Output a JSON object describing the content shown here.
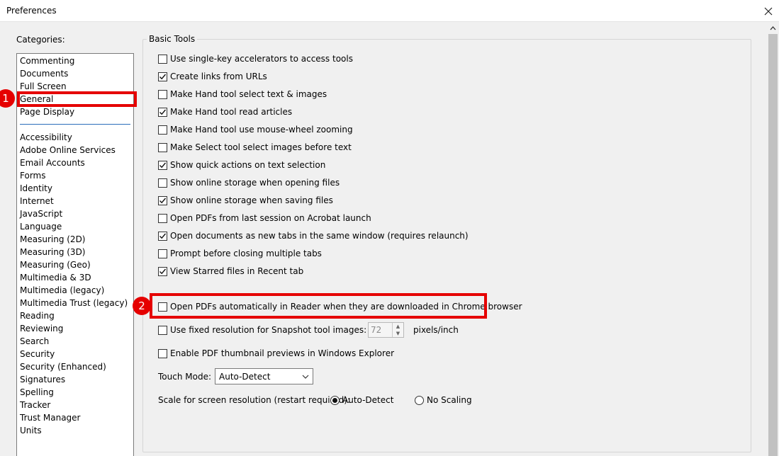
{
  "window": {
    "title": "Preferences"
  },
  "categories": {
    "label": "Categories:",
    "group1": [
      "Commenting",
      "Documents",
      "Full Screen",
      "General",
      "Page Display"
    ],
    "group2": [
      "Accessibility",
      "Adobe Online Services",
      "Email Accounts",
      "Forms",
      "Identity",
      "Internet",
      "JavaScript",
      "Language",
      "Measuring (2D)",
      "Measuring (3D)",
      "Measuring (Geo)",
      "Multimedia & 3D",
      "Multimedia (legacy)",
      "Multimedia Trust (legacy)",
      "Reading",
      "Reviewing",
      "Search",
      "Security",
      "Security (Enhanced)",
      "Signatures",
      "Spelling",
      "Tracker",
      "Trust Manager",
      "Units"
    ],
    "selected": "General"
  },
  "annotations": {
    "badge1": "1",
    "badge2": "2"
  },
  "basic_tools": {
    "title": "Basic Tools",
    "options": [
      {
        "label": "Use single-key accelerators to access tools",
        "checked": false
      },
      {
        "label": "Create links from URLs",
        "checked": true
      },
      {
        "label": "Make Hand tool select text & images",
        "checked": false
      },
      {
        "label": "Make Hand tool read articles",
        "checked": true
      },
      {
        "label": "Make Hand tool use mouse-wheel zooming",
        "checked": false
      },
      {
        "label": "Make Select tool select images before text",
        "checked": false
      },
      {
        "label": "Show quick actions on text selection",
        "checked": true
      },
      {
        "label": "Show online storage when opening files",
        "checked": false
      },
      {
        "label": "Show online storage when saving files",
        "checked": true
      },
      {
        "label": "Open PDFs from last session on Acrobat launch",
        "checked": false
      },
      {
        "label": "Open documents as new tabs in the same window (requires relaunch)",
        "checked": true
      },
      {
        "label": "Prompt before closing multiple tabs",
        "checked": false
      },
      {
        "label": "View Starred files in Recent tab",
        "checked": true
      }
    ],
    "chrome_option": {
      "label": "Open PDFs automatically in Reader when they are downloaded in Chrome browser",
      "checked": false
    },
    "fixed_resolution": {
      "label": "Use fixed resolution for Snapshot tool images:",
      "checked": false,
      "value": "72",
      "unit": "pixels/inch"
    },
    "thumbnail": {
      "label": "Enable PDF thumbnail previews in Windows Explorer",
      "checked": false
    },
    "touch_mode": {
      "label": "Touch Mode:",
      "value": "Auto-Detect"
    },
    "scale": {
      "label": "Scale for screen resolution (restart required):",
      "option1": "Auto-Detect",
      "option2": "No Scaling",
      "selected": "Auto-Detect"
    }
  },
  "colors": {
    "highlight": "#e50000",
    "separator": "#2a6ebb"
  }
}
